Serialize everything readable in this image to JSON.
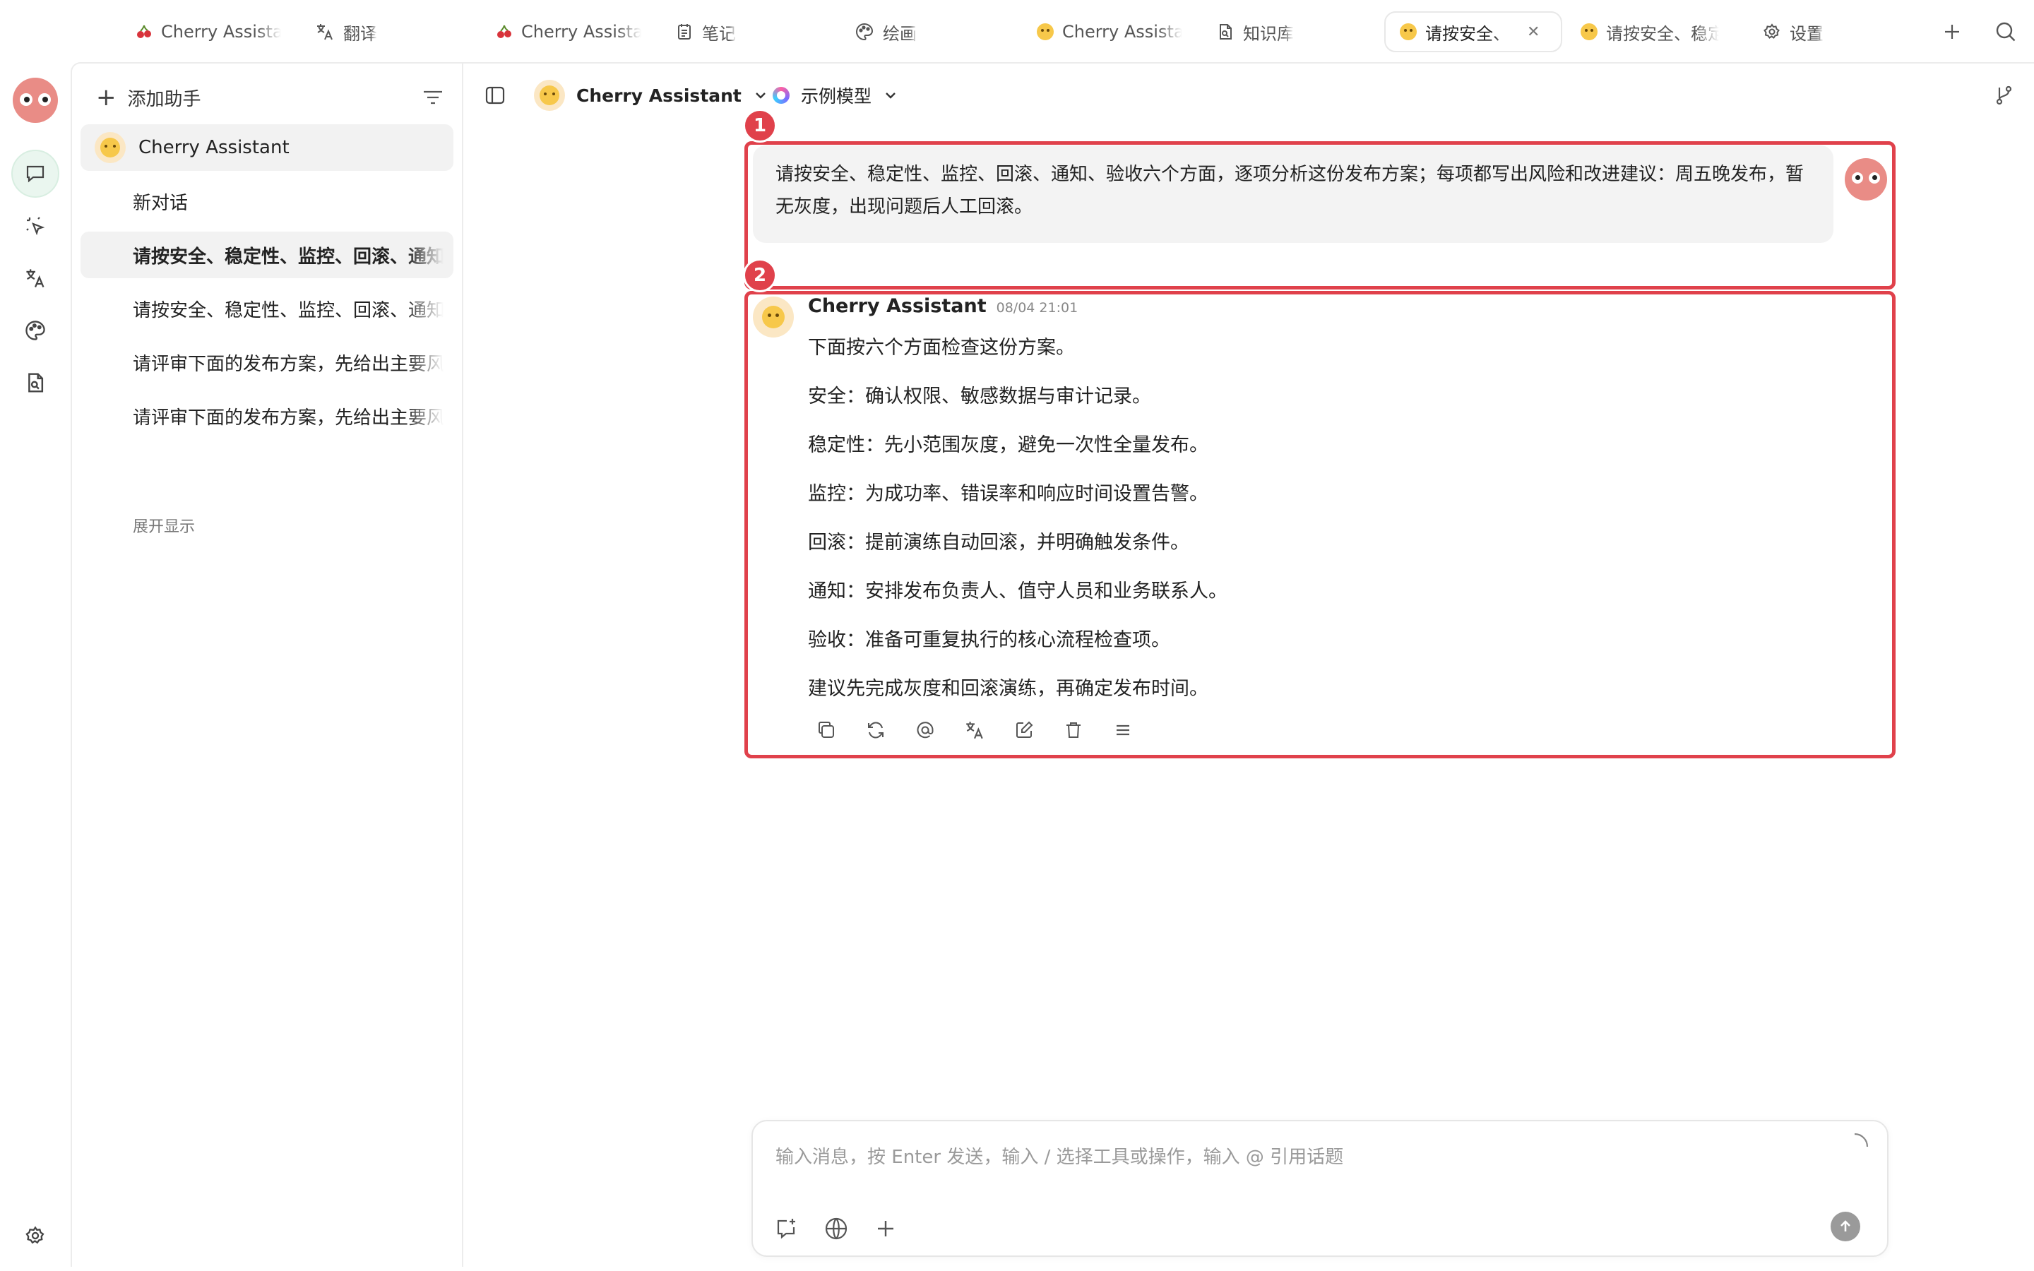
{
  "tabs": [
    {
      "label": "Cherry Assistant",
      "icon": "cherry-icon"
    },
    {
      "label": "翻译",
      "icon": "translate-icon"
    },
    {
      "label": "Cherry Assistant",
      "icon": "cherry-icon"
    },
    {
      "label": "笔记",
      "icon": "notes-icon"
    },
    {
      "label": "绘画",
      "icon": "palette-icon"
    },
    {
      "label": "Cherry Assistant",
      "icon": "smiley-icon"
    },
    {
      "label": "知识库",
      "icon": "knowledge-icon"
    },
    {
      "label": "请按安全、",
      "icon": "smiley-icon",
      "active": true
    },
    {
      "label": "请按安全、稳定",
      "icon": "smiley-icon"
    },
    {
      "label": "设置",
      "icon": "gear-icon"
    }
  ],
  "sidebar": {
    "add_assistant": "添加助手",
    "assistant_name": "Cherry Assistant",
    "topics": [
      "新对话",
      "请按安全、稳定性、监控、回滚、通知",
      "请按安全、稳定性、监控、回滚、通知",
      "请评审下面的发布方案，先给出主要风",
      "请评审下面的发布方案，先给出主要风"
    ],
    "expand": "展开显示"
  },
  "header": {
    "assistant": "Cherry Assistant",
    "model": "示例模型"
  },
  "badges": [
    "1",
    "2"
  ],
  "user_message": "请按安全、稳定性、监控、回滚、通知、验收六个方面，逐项分析这份发布方案；每项都写出风险和改进建议：周五晚发布，暂无灰度，出现问题后人工回滚。",
  "assistant_message": {
    "name": "Cherry Assistant",
    "time": "08/04 21:01",
    "paragraphs": [
      "下面按六个方面检查这份方案。",
      "安全：确认权限、敏感数据与审计记录。",
      "稳定性：先小范围灰度，避免一次性全量发布。",
      "监控：为成功率、错误率和响应时间设置告警。",
      "回滚：提前演练自动回滚，并明确触发条件。",
      "通知：安排发布负责人、值守人员和业务联系人。",
      "验收：准备可重复执行的核心流程检查项。",
      "建议先完成灰度和回滚演练，再确定发布时间。"
    ]
  },
  "composer": {
    "placeholder": "输入消息，按 Enter 发送，输入 / 选择工具或操作，输入 @ 引用话题"
  },
  "colors": {
    "highlight": "#e0414b",
    "active_rail": "#eaf6ef",
    "bubble": "#f3f3f3"
  }
}
